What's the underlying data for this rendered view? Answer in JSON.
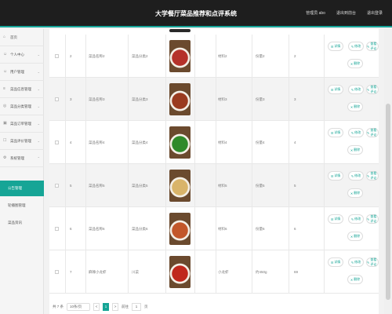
{
  "header": {
    "title": "大学餐厅菜品推荐和点评系统",
    "admin_label": "管理员 abo",
    "backend_label": "退出到前台",
    "logout_label": "退出登录"
  },
  "sidebar": {
    "items": [
      {
        "label": "首页",
        "icon": "home-icon"
      },
      {
        "label": "个人中心",
        "icon": "user-icon"
      },
      {
        "label": "用户管理",
        "icon": "users-icon"
      },
      {
        "label": "菜品信息管理",
        "icon": "list-icon"
      },
      {
        "label": "菜品分类管理",
        "icon": "category-icon"
      },
      {
        "label": "菜品订单管理",
        "icon": "order-icon"
      },
      {
        "label": "菜品评价管理",
        "icon": "comment-icon"
      },
      {
        "label": "系统管理",
        "icon": "gear-icon"
      }
    ],
    "subitems": [
      {
        "label": "公告管理",
        "active": true
      },
      {
        "label": "轮播图管理",
        "active": false
      },
      {
        "label": "菜品资讯",
        "active": false
      }
    ]
  },
  "table": {
    "rows": [
      {
        "num": "2",
        "name": "菜品名称2",
        "category": "菜品分类2",
        "material": "材料2",
        "amount": "份量2",
        "price": "2",
        "food_color": "#b5322a"
      },
      {
        "num": "3",
        "name": "菜品名称3",
        "category": "菜品分类3",
        "material": "材料3",
        "amount": "份量3",
        "price": "3",
        "food_color": "#9a3b1f"
      },
      {
        "num": "4",
        "name": "菜品名称4",
        "category": "菜品分类4",
        "material": "材料4",
        "amount": "份量4",
        "price": "4",
        "food_color": "#2f8a2a"
      },
      {
        "num": "5",
        "name": "菜品名称5",
        "category": "菜品分类5",
        "material": "材料5",
        "amount": "份量5",
        "price": "5",
        "food_color": "#d9b46a"
      },
      {
        "num": "6",
        "name": "菜品名称6",
        "category": "菜品分类6",
        "material": "材料6",
        "amount": "份量6",
        "price": "6",
        "food_color": "#c2572a"
      },
      {
        "num": "7",
        "name": "麻辣小龙虾",
        "category": "川菜",
        "material": "小龙虾",
        "amount": "约450g",
        "price": "69",
        "food_color": "#c0281c"
      }
    ],
    "actions": {
      "detail": "详情",
      "edit": "修改",
      "review": "查看评论",
      "delete": "删除"
    }
  },
  "pager": {
    "total": "共 7 条",
    "page_size": "10条/页",
    "prev": "<",
    "current": "1",
    "next": ">",
    "goto_label": "前往",
    "goto_value": "1",
    "page_suffix": "页"
  },
  "colors": {
    "accent": "#16a596",
    "topbar": "#1e1e1e"
  }
}
